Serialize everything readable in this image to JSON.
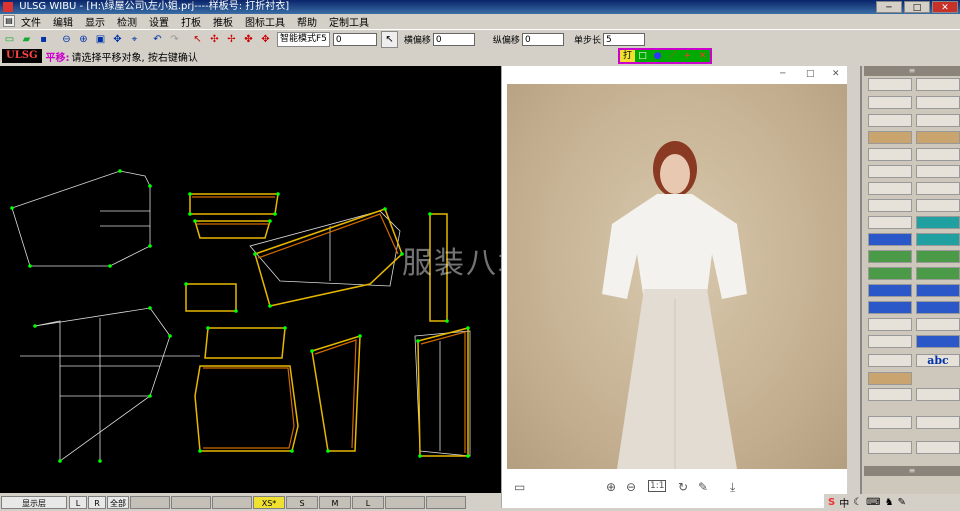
{
  "titlebar": {
    "title": "ULSG WIBU - [H:\\绿屋公司\\左小姐.prj----样板号: 打折衬衣]"
  },
  "menu": [
    "文件",
    "编辑",
    "显示",
    "检测",
    "设置",
    "打板",
    "推板",
    "图标工具",
    "帮助",
    "定制工具"
  ],
  "toolbar": {
    "mode_select": "智能模式F5",
    "mode_value": "0",
    "h_label": "横偏移",
    "h_value": "0",
    "v_label": "纵偏移",
    "v_value": "0",
    "step_label": "单步长",
    "step_value": "5"
  },
  "status": {
    "logo": "ULSG",
    "mode": "平移:",
    "hint": "请选择平移对象, 按右键确认"
  },
  "snap_toggles": [
    "打",
    "□",
    "●",
    "／",
    "+",
    "✕"
  ],
  "viewer": {
    "watermark": "服装八场"
  },
  "bottom": {
    "layer": "显示层",
    "left": "L",
    "right": "R",
    "all": "全部",
    "sizes": [
      "XS*",
      "S",
      "M",
      "L"
    ]
  },
  "colors": {
    "canvas": "#000000",
    "pattern_yellow": "#e8b800",
    "pattern_orange": "#d06a00",
    "guide_white": "#dddddd",
    "node_green": "#00ff00",
    "accent_pink": "#c0c"
  },
  "rightpanel": {
    "labels": [
      "abc"
    ]
  }
}
